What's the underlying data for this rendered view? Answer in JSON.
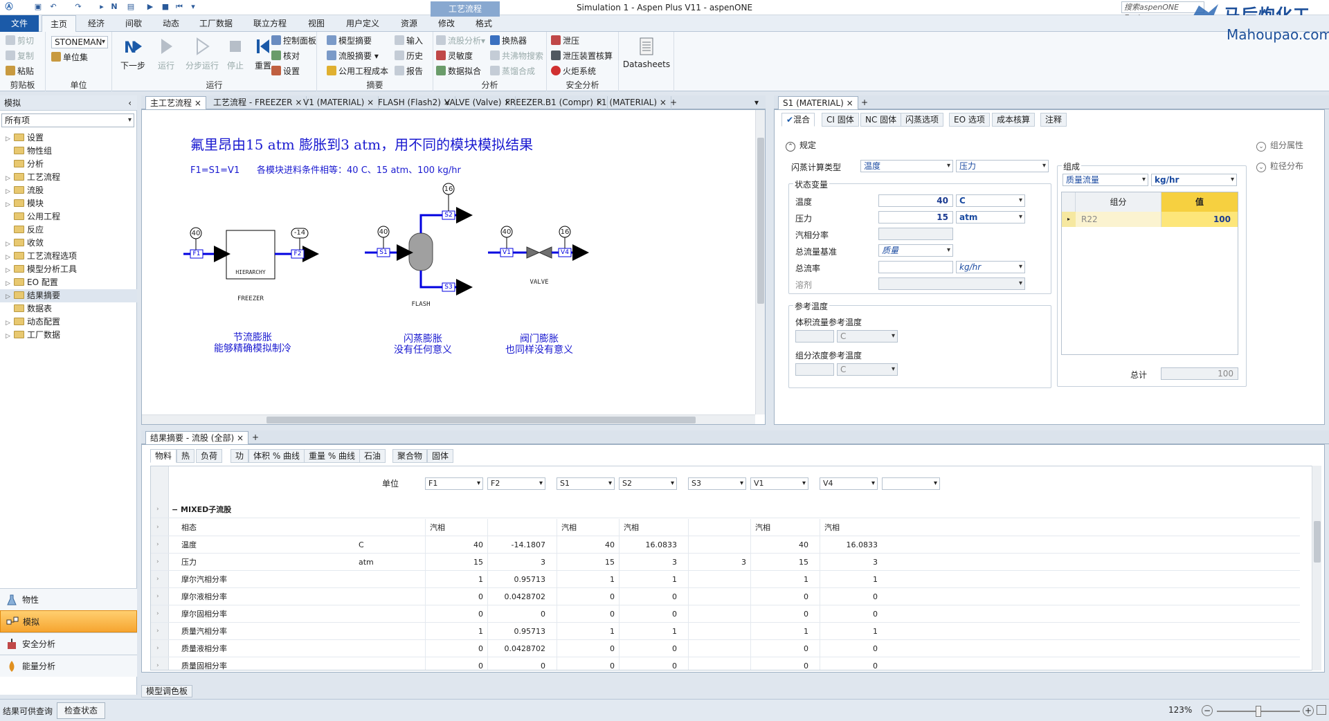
{
  "window": {
    "title": "Simulation 1 - Aspen Plus V11 - aspenONE",
    "search_placeholder": "搜索aspenONE Exchange",
    "watermark_cn": "马后炮化工",
    "watermark_url": "Mahoupao.com"
  },
  "ribbon_tabs": [
    "文件",
    "主页",
    "经济",
    "间歇",
    "动态",
    "工厂数据",
    "联立方程",
    "视图",
    "用户定义",
    "资源",
    "修改",
    "格式"
  ],
  "context_tab": "工艺流程",
  "ribbon": {
    "clipboard": {
      "label": "剪贴板",
      "cut": "剪切",
      "copy": "复制",
      "paste": "粘贴"
    },
    "units": {
      "label": "单位",
      "combo": "STONEMAN",
      "unitset": "单位集"
    },
    "run": {
      "label": "运行",
      "next": "下一步",
      "run": "运行",
      "step": "分步运行",
      "stop": "停止",
      "reset": "重置",
      "control_panel": "控制面板",
      "check": "核对",
      "settings": "设置"
    },
    "summary": {
      "label": "摘要",
      "model_summary": "模型摘要",
      "stream_summary": "流股摘要",
      "utility_cost": "公用工程成本",
      "input": "输入",
      "history": "历史",
      "report": "报告"
    },
    "analysis": {
      "label": "分析",
      "stream_analysis": "流股分析",
      "sensitivity": "灵敏度",
      "data_fit": "数据拟合",
      "heat_exchanger": "换热器",
      "azeotrope": "共沸物搜索",
      "distill_synth": "蒸馏合成"
    },
    "safety": {
      "label": "安全分析",
      "pressure_relief": "泄压",
      "relief_sizing": "泄压装置核算",
      "flare": "火炬系统"
    },
    "datasheets": "Datasheets"
  },
  "left": {
    "title": "模拟",
    "filter": "所有项",
    "tree": [
      {
        "label": "设置",
        "arrow": true
      },
      {
        "label": "物性组",
        "arrow": false
      },
      {
        "label": "分析",
        "arrow": false
      },
      {
        "label": "工艺流程",
        "arrow": true
      },
      {
        "label": "流股",
        "arrow": true
      },
      {
        "label": "模块",
        "arrow": true
      },
      {
        "label": "公用工程",
        "arrow": false
      },
      {
        "label": "反应",
        "arrow": false
      },
      {
        "label": "收敛",
        "arrow": true
      },
      {
        "label": "工艺流程选项",
        "arrow": true
      },
      {
        "label": "模型分析工具",
        "arrow": true
      },
      {
        "label": "EO 配置",
        "arrow": true
      },
      {
        "label": "结果摘要",
        "arrow": true,
        "selected": true
      },
      {
        "label": "数据表",
        "arrow": false
      },
      {
        "label": "动态配置",
        "arrow": true
      },
      {
        "label": "工厂数据",
        "arrow": true
      }
    ],
    "nav": [
      "物性",
      "模拟",
      "安全分析",
      "能量分析"
    ]
  },
  "doc_tabs": [
    "主工艺流程",
    "工艺流程 - FREEZER",
    "V1 (MATERIAL)",
    "FLASH (Flash2)",
    "VALVE (Valve)",
    "FREEZER.B1 (Compr)",
    "F1 (MATERIAL)"
  ],
  "flowsheet": {
    "heading": "氟里昂由15 atm 膨胀到3 atm，用不同的模块模拟结果",
    "subheading": "F1=S1=V1      各模块进料条件相等：40 C、15 atm、100 kg/hr",
    "freezer": {
      "in_tag": "40",
      "out_tag": "-14",
      "in_stream": "F1",
      "out_stream": "F2",
      "block": "HIERARCHY",
      "name": "FREEZER",
      "note1": "节流膨胀",
      "note2": "能够精确模拟制冷"
    },
    "flash": {
      "in_tag": "40",
      "top_tag": "16",
      "in_stream": "S1",
      "top_stream": "S2",
      "bottom_stream": "S3",
      "name": "FLASH",
      "note1": "闪蒸膨胀",
      "note2": "没有任何意义"
    },
    "valve": {
      "in_tag": "40",
      "out_tag": "16",
      "in_stream": "V1",
      "out_stream": "V4",
      "name": "VALVE",
      "note1": "阀门膨胀",
      "note2": "也同样没有意义"
    }
  },
  "stream_form": {
    "tab": "S1 (MATERIAL)",
    "subtabs": [
      "混合",
      "CI 固体",
      "NC 固体",
      "闪蒸选项",
      "EO 选项",
      "成本核算",
      "注释"
    ],
    "spec": "规定",
    "flash_type_label": "闪蒸计算类型",
    "flash_type1": "温度",
    "flash_type2": "压力",
    "state_vars": "状态变量",
    "temp_label": "温度",
    "temp_val": "40",
    "temp_unit": "C",
    "pres_label": "压力",
    "pres_val": "15",
    "pres_unit": "atm",
    "vfrac_label": "汽相分率",
    "basis_label": "总流量基准",
    "basis_val": "质量",
    "flow_label": "总流率",
    "flow_unit": "kg/hr",
    "solvent_label": "溶剂",
    "ref_temp": "参考温度",
    "vol_ref": "体积流量参考温度",
    "vol_unit": "C",
    "conc_ref": "组分浓度参考温度",
    "conc_unit": "C",
    "composition": "组成",
    "comp_basis": "质量流量",
    "comp_unit": "kg/hr",
    "col_comp": "组分",
    "col_val": "值",
    "comp_name": "R22",
    "comp_value": "100",
    "total_label": "总计",
    "total_val": "100",
    "comp_attr": "组分属性",
    "psd": "粒径分布"
  },
  "results": {
    "tab": "结果摘要 - 流股 (全部)",
    "subtabs": [
      "物料",
      "热",
      "负荷",
      "功",
      "体积 % 曲线",
      "重量 % 曲线",
      "石油",
      "聚合物",
      "固体"
    ],
    "unit_header": "单位",
    "streams": [
      "F1",
      "F2",
      "S1",
      "S2",
      "S3",
      "V1",
      "V4",
      ""
    ],
    "group": "MIXED子流股",
    "rows": [
      {
        "label": "相态",
        "unit": "",
        "vals": [
          "汽相",
          "",
          "汽相",
          "汽相",
          "",
          "汽相",
          "汽相"
        ],
        "text": true
      },
      {
        "label": "温度",
        "unit": "C",
        "vals": [
          "40",
          "-14.1807",
          "40",
          "16.0833",
          "",
          "40",
          "16.0833"
        ]
      },
      {
        "label": "压力",
        "unit": "atm",
        "vals": [
          "15",
          "3",
          "15",
          "3",
          "3",
          "15",
          "3"
        ]
      },
      {
        "label": "摩尔汽相分率",
        "unit": "",
        "vals": [
          "1",
          "0.95713",
          "1",
          "1",
          "",
          "1",
          "1"
        ]
      },
      {
        "label": "摩尔液相分率",
        "unit": "",
        "vals": [
          "0",
          "0.0428702",
          "0",
          "0",
          "",
          "0",
          "0"
        ]
      },
      {
        "label": "摩尔固相分率",
        "unit": "",
        "vals": [
          "0",
          "0",
          "0",
          "0",
          "",
          "0",
          "0"
        ]
      },
      {
        "label": "质量汽相分率",
        "unit": "",
        "vals": [
          "1",
          "0.95713",
          "1",
          "1",
          "",
          "1",
          "1"
        ]
      },
      {
        "label": "质量液相分率",
        "unit": "",
        "vals": [
          "0",
          "0.0428702",
          "0",
          "0",
          "",
          "0",
          "0"
        ]
      },
      {
        "label": "质量固相分率",
        "unit": "",
        "vals": [
          "0",
          "0",
          "0",
          "0",
          "",
          "0",
          "0"
        ]
      }
    ]
  },
  "palette_tab": "模型调色板",
  "status": {
    "msg": "结果可供查询",
    "check": "检查状态",
    "zoom": "123%"
  }
}
